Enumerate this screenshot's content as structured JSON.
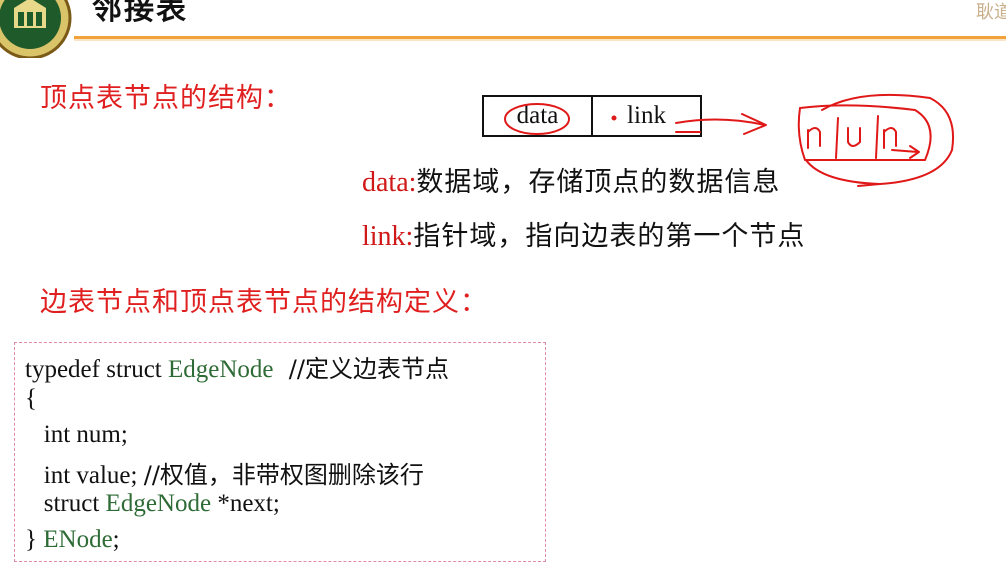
{
  "header": {
    "title": "邻接表",
    "corner_text": "耿道"
  },
  "section1": {
    "title": "顶点表节点的结构："
  },
  "node_struct": {
    "fields": [
      "data",
      "link"
    ]
  },
  "descriptions": [
    {
      "key": "data:",
      "text": "数据域，存储顶点的数据信息"
    },
    {
      "key": "link:",
      "text": "指针域，指向边表的第一个节点"
    }
  ],
  "section2": {
    "title": "边表节点和顶点表节点的结构定义："
  },
  "code": {
    "line1_a": "typedef struct ",
    "line1_type": "EdgeNode",
    "line1_comment": "  //定义边表节点",
    "line2": "{",
    "line3": "   int num;",
    "line4_a": "   int value; ",
    "line4_comment": "//权值，非带权图删除该行",
    "line5_a": "   struct ",
    "line5_type": "EdgeNode",
    "line5_b": " *next;",
    "line6_a": "} ",
    "line6_type": "ENode",
    "line6_b": ";"
  },
  "colors": {
    "accent_red": "#e02020",
    "code_type_green": "#2e6b36",
    "header_orange": "#f2a23a",
    "dashed_border_pink": "#e48aa8",
    "ink_red": "#e01818"
  }
}
